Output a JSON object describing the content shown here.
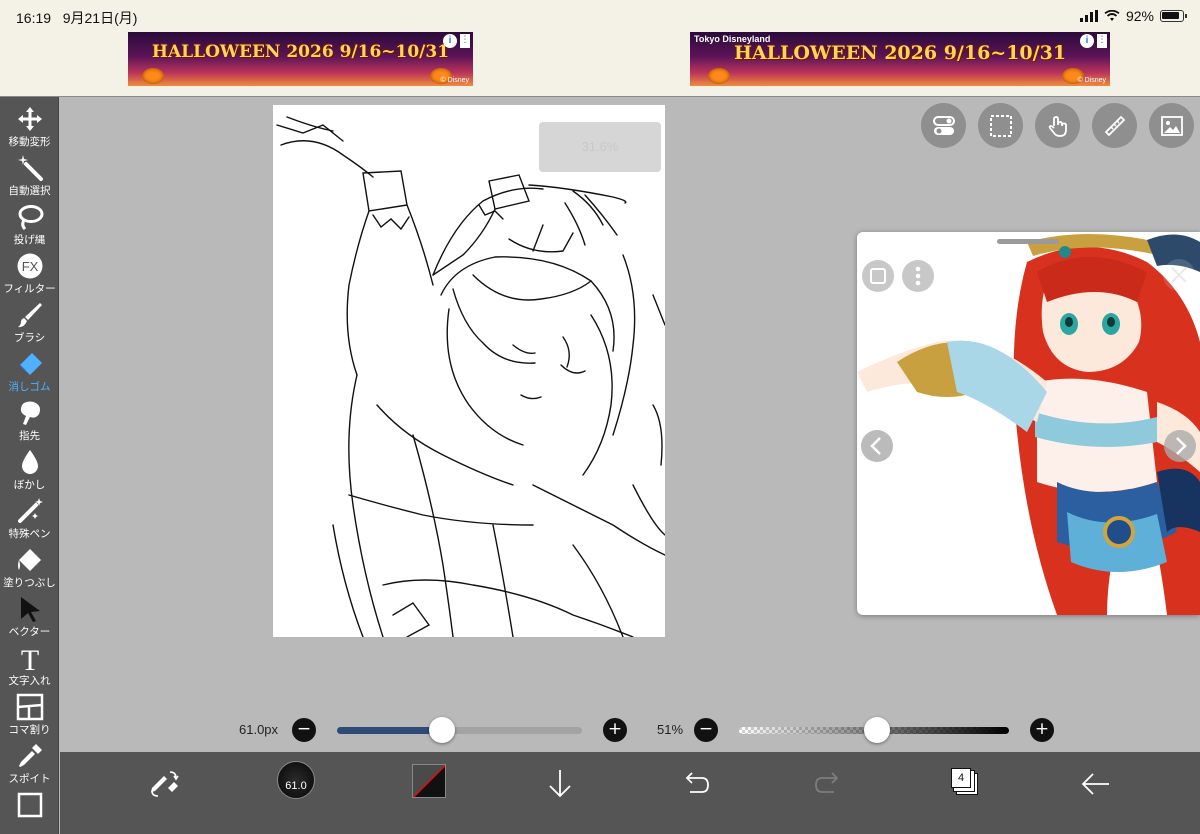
{
  "status_bar": {
    "time": "16:19",
    "date": "9月21日(月)",
    "battery": "92%",
    "icons": [
      "signal-icon",
      "wifi-icon",
      "battery-icon"
    ]
  },
  "ads": [
    {
      "brand": "",
      "headline": "HALLOWEEN 2026 9/16~10/31",
      "copyright": "© Disney",
      "info": "i",
      "more": "⋮"
    },
    {
      "brand": "Tokyo Disneyland",
      "headline": "HALLOWEEN 2026 9/16~10/31",
      "copyright": "© Disney",
      "info": "i",
      "more": "⋮"
    }
  ],
  "toolbar": {
    "active": "eraser",
    "items": [
      {
        "id": "move",
        "label": "移動変形",
        "icon": "move-arrows-icon"
      },
      {
        "id": "magic",
        "label": "自動選択",
        "icon": "magic-wand-icon"
      },
      {
        "id": "lasso",
        "label": "投げ縄",
        "icon": "lasso-icon"
      },
      {
        "id": "filter",
        "label": "フィルター",
        "icon": "fx-icon",
        "glyph": "FX"
      },
      {
        "id": "brush",
        "label": "ブラシ",
        "icon": "brush-icon"
      },
      {
        "id": "eraser",
        "label": "消しゴム",
        "icon": "eraser-icon"
      },
      {
        "id": "smudge",
        "label": "指先",
        "icon": "finger-icon"
      },
      {
        "id": "blur",
        "label": "ぼかし",
        "icon": "droplet-icon"
      },
      {
        "id": "special",
        "label": "特殊ペン",
        "icon": "sparkle-pen-icon"
      },
      {
        "id": "fill",
        "label": "塗りつぶし",
        "icon": "bucket-icon"
      },
      {
        "id": "vector",
        "label": "ベクター",
        "icon": "vector-arrow-icon"
      },
      {
        "id": "text",
        "label": "文字入れ",
        "icon": "text-t-icon",
        "glyph": "T"
      },
      {
        "id": "frame",
        "label": "コマ割り",
        "icon": "frame-divider-icon"
      },
      {
        "id": "eyedropper",
        "label": "スポイト",
        "icon": "eyedropper-icon"
      }
    ]
  },
  "canvas": {
    "zoom_toast": "31.6%"
  },
  "top_right_buttons": [
    "toggle-icon",
    "selection-icon",
    "hand-touch-icon",
    "ruler-icon",
    "image-icon"
  ],
  "reference": {
    "prev": "<",
    "next": ">",
    "close": "×"
  },
  "brush_size": {
    "label": "61.0px",
    "value": 0.43,
    "minus": "−",
    "plus": "+"
  },
  "opacity": {
    "label": "51%",
    "value": 0.51,
    "minus": "−",
    "plus": "+"
  },
  "bottom_bar": {
    "brush_size_value": "61.0",
    "layer_count": "4",
    "colors": {
      "primary": "#111111",
      "secondary": "#d01018"
    }
  }
}
